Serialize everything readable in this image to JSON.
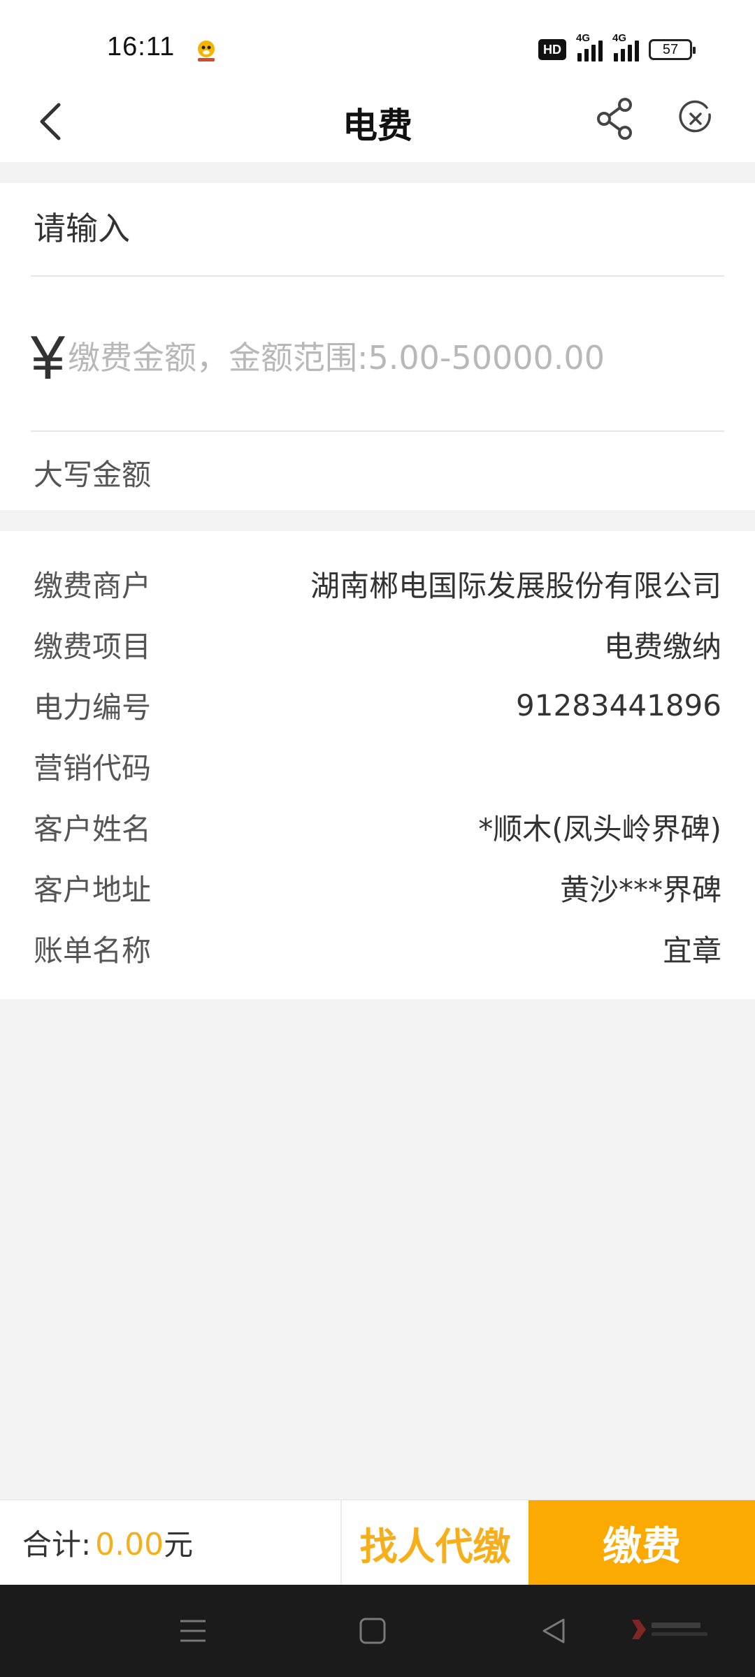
{
  "status_bar": {
    "time": "16:11",
    "app_icon": "app-mascot-icon",
    "hd_label": "HD",
    "network1": "4G",
    "network2": "4G",
    "battery": "57"
  },
  "nav": {
    "title": "电费",
    "back_icon": "chevron-left-icon",
    "share_icon": "share-icon",
    "close_icon": "close-circle-icon"
  },
  "form": {
    "account_placeholder": "请输入",
    "currency_symbol": "¥",
    "amount_placeholder": "缴费金额，金额范围:5.00-50000.00",
    "uppercase_label": "大写金额"
  },
  "info": {
    "rows": [
      {
        "label": "缴费商户",
        "value": "湖南郴电国际发展股份有限公司"
      },
      {
        "label": "缴费项目",
        "value": "电费缴纳"
      },
      {
        "label": "电力编号",
        "value": "91283441896"
      },
      {
        "label": "营销代码",
        "value": ""
      },
      {
        "label": "客户姓名",
        "value": "*顺木(凤头岭界碑)"
      },
      {
        "label": "客户地址",
        "value": "黄沙***界碑"
      },
      {
        "label": "账单名称",
        "value": "宜章"
      }
    ]
  },
  "bottom": {
    "total_label": "合计:",
    "total_amount": "0.00",
    "total_unit": "元",
    "proxy_button": "找人代缴",
    "pay_button": "缴费"
  },
  "system_nav": {
    "menu_icon": "menu-icon",
    "home_icon": "home-square-icon",
    "back_icon": "triangle-back-icon"
  },
  "colors": {
    "accent": "#fbaa04",
    "accent_text": "#f7ae1b",
    "background": "#f3f3f3"
  }
}
